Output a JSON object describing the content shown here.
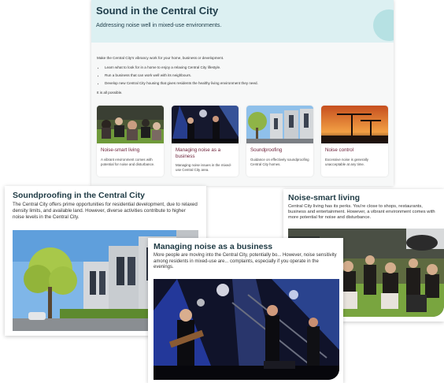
{
  "page": {
    "title": "Sound in the Central City",
    "subtitle": "Addressing noise well in mixed-use environments.",
    "intro": "Make the Central City's vibrancy work for your home, business or development.",
    "bullets": [
      "Learn what to look for in a home to enjoy a relaxing Central City lifestyle.",
      "Run a business that can work well with its neighbours.",
      "Develop new Central City housing that gives residents the healthy living environment they need."
    ],
    "closing": "It is all possible."
  },
  "cards": [
    {
      "title": "Noise-smart living",
      "text": "A vibrant environment comes with potential for noise and disturbance."
    },
    {
      "title": "Managing noise as a business",
      "text": "Managing noise issues in the mixed-use Central City area."
    },
    {
      "title": "Soundproofing",
      "text": "Guidance on effectively soundproofing Central City homes."
    },
    {
      "title": "Noise control",
      "text": "Excessive noise is generally unacceptable at any time."
    }
  ],
  "panels": {
    "soundproofing": {
      "title": "Soundproofing in the Central City",
      "text": "The Central City offers prime opportunities for residential development, due to relaxed density limits, and available land. However, diverse activities contribute to higher noise levels in the Central City."
    },
    "noise_smart": {
      "title": "Noise-smart living",
      "text": "Central City living has its perks. You're close to shops, restaurants, business and entertainment. However, a vibrant environment comes with more potential for noise and disturbance."
    },
    "managing": {
      "title": "Managing noise as a business",
      "text": "More people are moving into the Central City, potentially bo... However, noise sensitivity among residents in mixed-use are... complaints, especially if you operate in the evenings."
    }
  },
  "colors": {
    "header_bg": "#dcf0f2",
    "card_title": "#6a1d36",
    "heading": "#1e3a44"
  }
}
